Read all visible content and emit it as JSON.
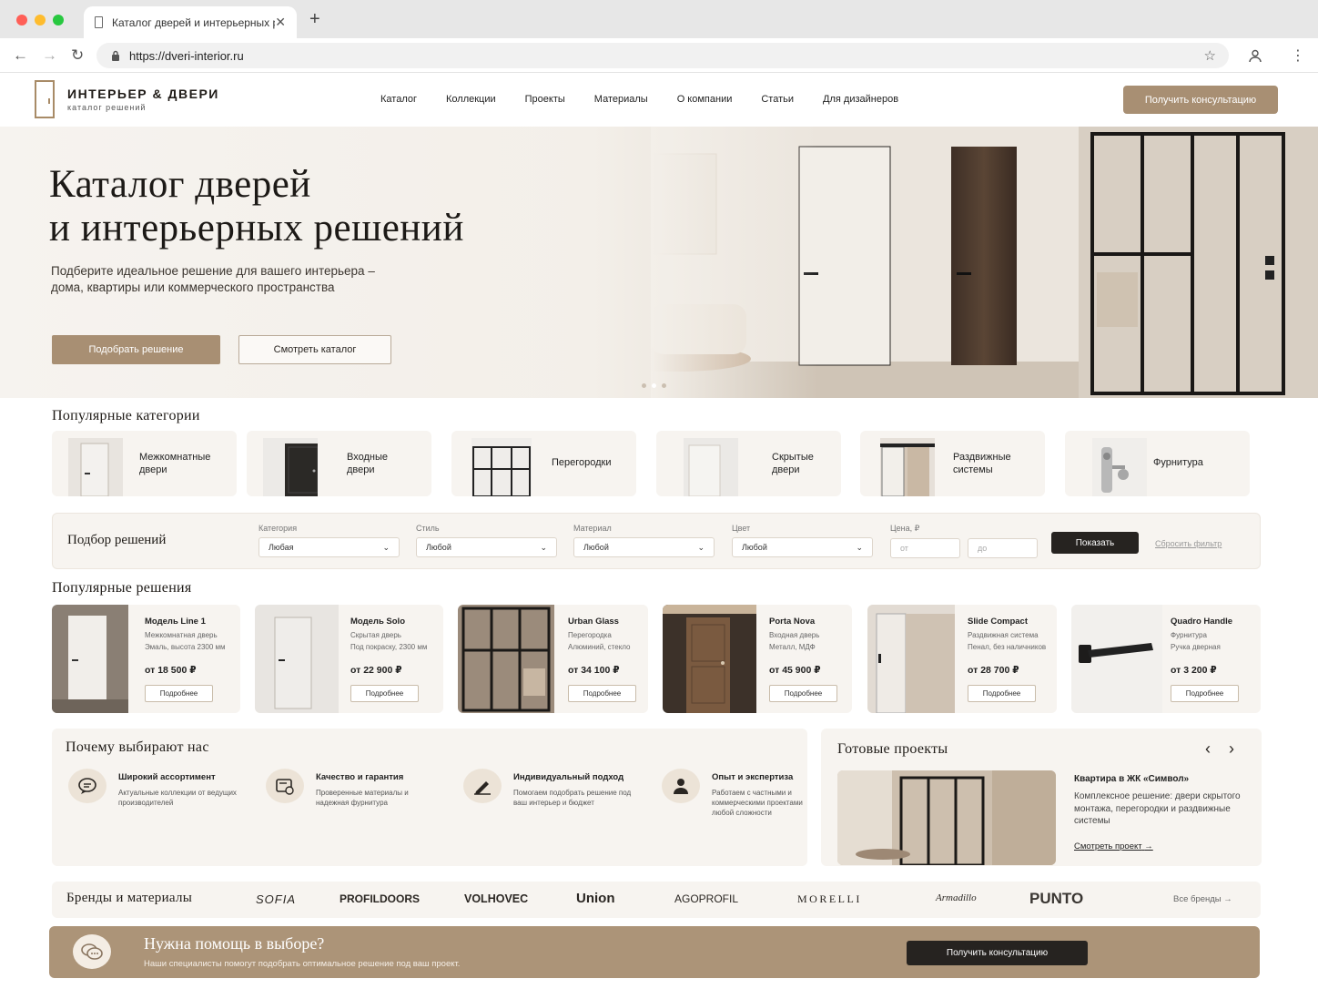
{
  "browser": {
    "tab_title": "Каталог дверей и интерьерных р",
    "url": "https://dveri-interior.ru"
  },
  "header": {
    "logo_title": "ИНТЕРЬЕР & ДВЕРИ",
    "logo_subtitle": "каталог решений",
    "menu": [
      "Каталог",
      "Коллекции",
      "Проекты",
      "Материалы",
      "О компании",
      "Статьи",
      "Для дизайнеров"
    ],
    "cta": "Получить консультацию"
  },
  "hero": {
    "title_line1": "Каталог дверей",
    "title_line2": "и интерьерных решений",
    "subtitle": "Подберите идеальное решение для вашего интерьера – дома, квартиры или коммерческого пространства",
    "btn_primary": "Подобрать решение",
    "btn_secondary": "Смотреть каталог",
    "slides_total": 3,
    "slide_active": 2
  },
  "categories": {
    "title": "Популярные категории",
    "items": [
      {
        "label": "Межкомнатные двери",
        "icon": "interior-door-icon"
      },
      {
        "label": "Входные двери",
        "icon": "entrance-door-icon"
      },
      {
        "label": "Перегородки",
        "icon": "partition-icon"
      },
      {
        "label": "Скрытые двери",
        "icon": "hidden-door-icon"
      },
      {
        "label": "Раздвижные системы",
        "icon": "sliding-door-icon"
      },
      {
        "label": "Фурнитура",
        "icon": "handle-icon"
      }
    ]
  },
  "filter": {
    "title": "Подбор решений",
    "category_label": "Категория",
    "category_value": "Любая",
    "style_label": "Стиль",
    "style_value": "Любой",
    "material_label": "Материал",
    "material_value": "Любой",
    "color_label": "Цвет",
    "color_value": "Любой",
    "price_label": "Цена, ₽",
    "price_from": "от",
    "price_to": "до",
    "show": "Показать",
    "reset": "Сбросить фильтр"
  },
  "products": {
    "title": "Популярные решения",
    "button": "Подробнее",
    "items": [
      {
        "name": "Модель Line 1",
        "type": "Межкомнатная дверь",
        "desc": "Эмаль, высота 2300 мм",
        "price": "от 18 500 ₽"
      },
      {
        "name": "Модель Solo",
        "type": "Скрытая дверь",
        "desc": "Под покраску, 2300 мм",
        "price": "от 22 900 ₽"
      },
      {
        "name": "Urban Glass",
        "type": "Перегородка",
        "desc": "Алюминий, стекло",
        "price": "от 34 100 ₽"
      },
      {
        "name": "Porta Nova",
        "type": "Входная дверь",
        "desc": "Металл, МДФ",
        "price": "от 45 900 ₽"
      },
      {
        "name": "Slide Compact",
        "type": "Раздвижная система",
        "desc": "Пенал, без наличников",
        "price": "от 28 700 ₽"
      },
      {
        "name": "Quadro Handle",
        "type": "Фурнитура",
        "desc": "Ручка дверная",
        "price": "от 3 200 ₽"
      }
    ]
  },
  "why": {
    "title": "Почему выбирают нас",
    "items": [
      {
        "title": "Широкий ассортимент",
        "desc": "Актуальные коллекции от ведущих производителей",
        "icon": "chat-bubble-icon"
      },
      {
        "title": "Качество и гарантия",
        "desc": "Проверенные материалы и надежная фурнитура",
        "icon": "quality-card-icon"
      },
      {
        "title": "Индивидуальный подход",
        "desc": "Помогаем подобрать решение под ваш интерьер и бюджет",
        "icon": "pen-icon"
      },
      {
        "title": "Опыт и экспертиза",
        "desc": "Работаем с частными и коммерческими проектами любой сложности",
        "icon": "person-icon"
      }
    ]
  },
  "projects": {
    "title": "Готовые проекты",
    "project_title": "Квартира в ЖК «Символ»",
    "project_desc": "Комплексное решение: двери скрытого монтажа, перегородки и раздвижные системы",
    "link": "Смотреть проект"
  },
  "brands": {
    "title": "Бренды и материалы",
    "items": [
      "SOFIA",
      "PROFILDOORS",
      "VOLHOVEC",
      "Union",
      "AGOPROFIL",
      "MORELLI",
      "Armadillo",
      "PUNTO"
    ],
    "all": "Все бренды"
  },
  "help": {
    "title": "Нужна помощь в выборе?",
    "subtitle": "Наши специалисты помогут подобрать оптимальное решение под ваш проект.",
    "cta": "Получить консультацию"
  },
  "colors": {
    "accent": "#a88f73",
    "dark": "#262320",
    "panel": "#f7f4f0"
  }
}
